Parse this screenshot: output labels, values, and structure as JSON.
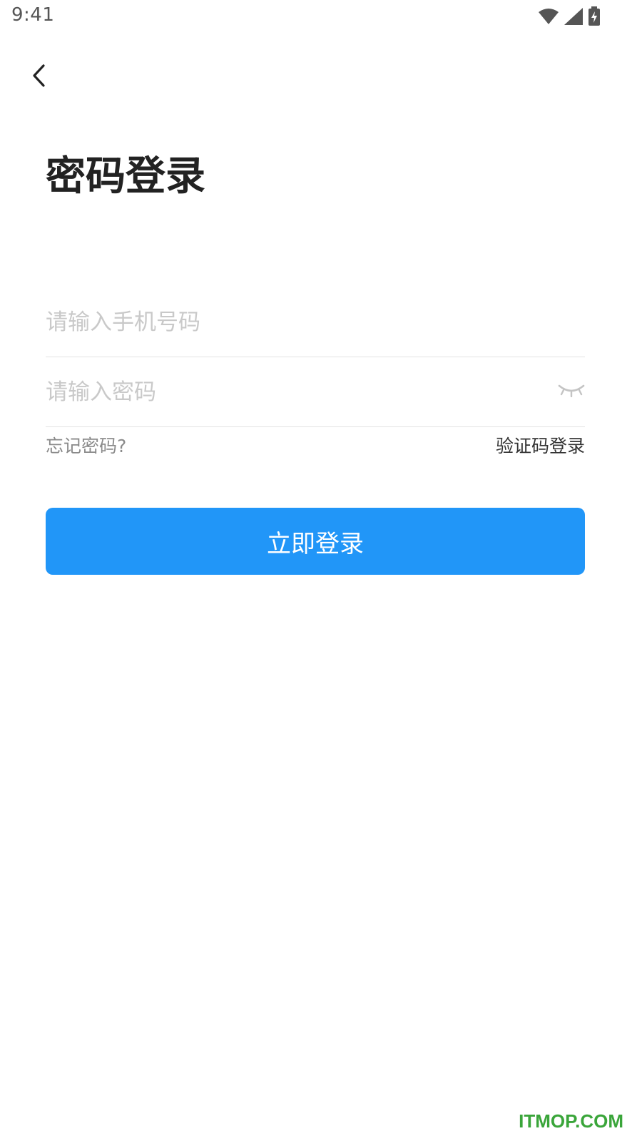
{
  "status_bar": {
    "time": "9:41",
    "icons": [
      "wifi-icon",
      "signal-icon",
      "battery-charging-icon"
    ]
  },
  "header": {
    "back_icon": "chevron-left-icon"
  },
  "page": {
    "title": "密码登录"
  },
  "form": {
    "phone_placeholder": "请输入手机号码",
    "phone_value": "",
    "password_placeholder": "请输入密码",
    "password_value": "",
    "password_toggle_icon": "eye-closed-icon",
    "forgot_password": "忘记密码?",
    "code_login": "验证码登录",
    "submit_label": "立即登录"
  },
  "colors": {
    "primary": "#2196f8",
    "placeholder": "#c9c9c9",
    "divider": "#e3e3e3",
    "muted_text": "#8a8a8a",
    "watermark": "#3aa53a"
  },
  "watermark": "ITMOP.COM"
}
